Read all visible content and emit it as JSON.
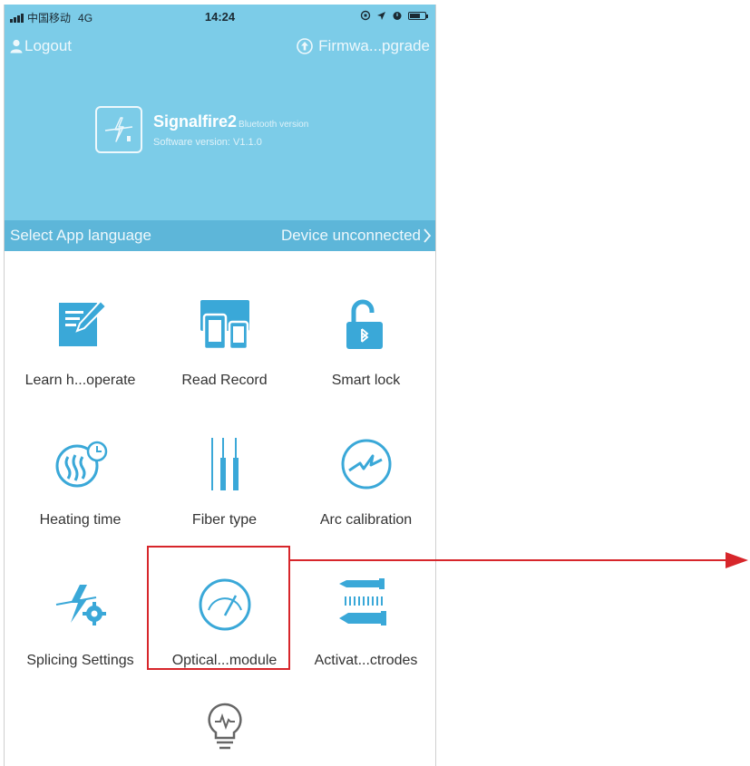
{
  "status_bar": {
    "carrier": "中国移动",
    "network": "4G",
    "time": "14:24"
  },
  "header": {
    "logout_label": "Logout",
    "firmware_label": "Firmwa...pgrade",
    "device_name": "Signalfire2",
    "device_subtitle": "Bluetooth version",
    "software_version": "Software version: V1.1.0",
    "language_label": "Select App language",
    "connection_status": "Device unconnected"
  },
  "menu": {
    "items": [
      {
        "label": "Learn h...operate",
        "icon": "learn-edit-icon"
      },
      {
        "label": "Read Record",
        "icon": "read-record-devices-icon"
      },
      {
        "label": "Smart lock",
        "icon": "smart-lock-icon"
      },
      {
        "label": "Heating time",
        "icon": "heating-time-icon"
      },
      {
        "label": "Fiber type",
        "icon": "fiber-type-icon"
      },
      {
        "label": "Arc calibration",
        "icon": "arc-calibration-icon"
      },
      {
        "label": "Splicing Settings",
        "icon": "splicing-settings-icon"
      },
      {
        "label": "Optical...module",
        "icon": "optical-module-gauge-icon"
      },
      {
        "label": "Activat...ctrodes",
        "icon": "activate-electrodes-icon"
      },
      {
        "label": "",
        "icon": "lightbulb-icon"
      }
    ]
  },
  "colors": {
    "header_bg": "#7ccce8",
    "language_bar_bg": "#5db6d9",
    "icon_blue": "#3aa8d8",
    "annotation_red": "#d7262b"
  }
}
